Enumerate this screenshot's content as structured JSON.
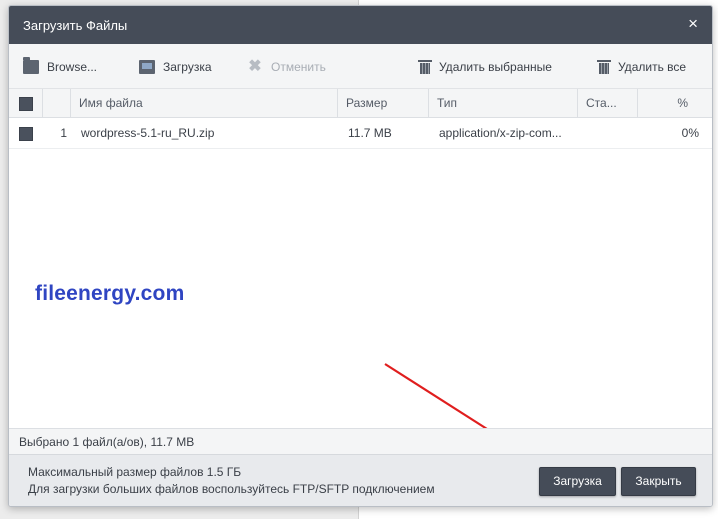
{
  "dialog": {
    "title": "Загрузить Файлы",
    "close_glyph": "×"
  },
  "toolbar": {
    "browse_label": "Browse...",
    "upload_label": "Загрузка",
    "cancel_label": "Отменить",
    "delete_selected_label": "Удалить выбранные",
    "delete_all_label": "Удалить все"
  },
  "table": {
    "columns": [
      "Имя файла",
      "Размер",
      "Тип",
      "Ста...",
      "%"
    ],
    "rows": [
      {
        "index": "1",
        "name": "wordpress-5.1-ru_RU.zip",
        "size": "11.7 MB",
        "type": "application/x-zip-com...",
        "status": "",
        "percent": "0%"
      }
    ]
  },
  "watermark": "fileenergy.com",
  "status": {
    "text": "Выбрано 1 файл(а/ов), 11.7 MB"
  },
  "footer": {
    "note1": "Максимальный размер файлов 1.5 ГБ",
    "note2": "Для загрузки больших файлов воспользуйтесь FTP/SFTP подключением",
    "upload_button": "Загрузка",
    "close_button": "Закрыть"
  },
  "colors": {
    "titlebar": "#454c58",
    "arrow": "#e01e1e",
    "watermark": "#2f45c2"
  }
}
